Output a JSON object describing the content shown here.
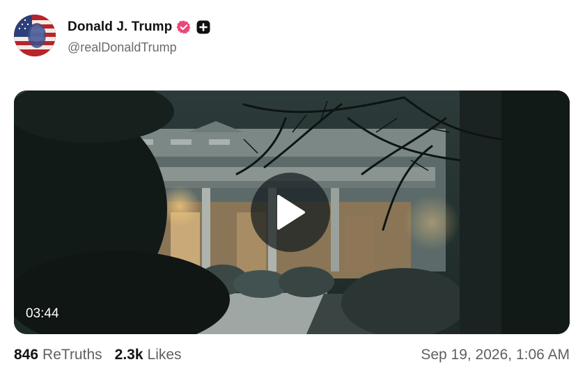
{
  "post": {
    "author": {
      "display_name": "Donald J. Trump",
      "handle": "@realDonaldTrump",
      "verified_icon": "verified-badge-icon",
      "badge_icon": "plus-square-icon",
      "verified_color": "#e8497a"
    },
    "video": {
      "duration": "03:44",
      "play_icon": "play-icon"
    },
    "stats": {
      "retruths_count": "846",
      "retruths_label": "ReTruths",
      "likes_count": "2.3k",
      "likes_label": "Likes"
    },
    "timestamp": "Sep 19, 2026, 1:06 AM"
  }
}
